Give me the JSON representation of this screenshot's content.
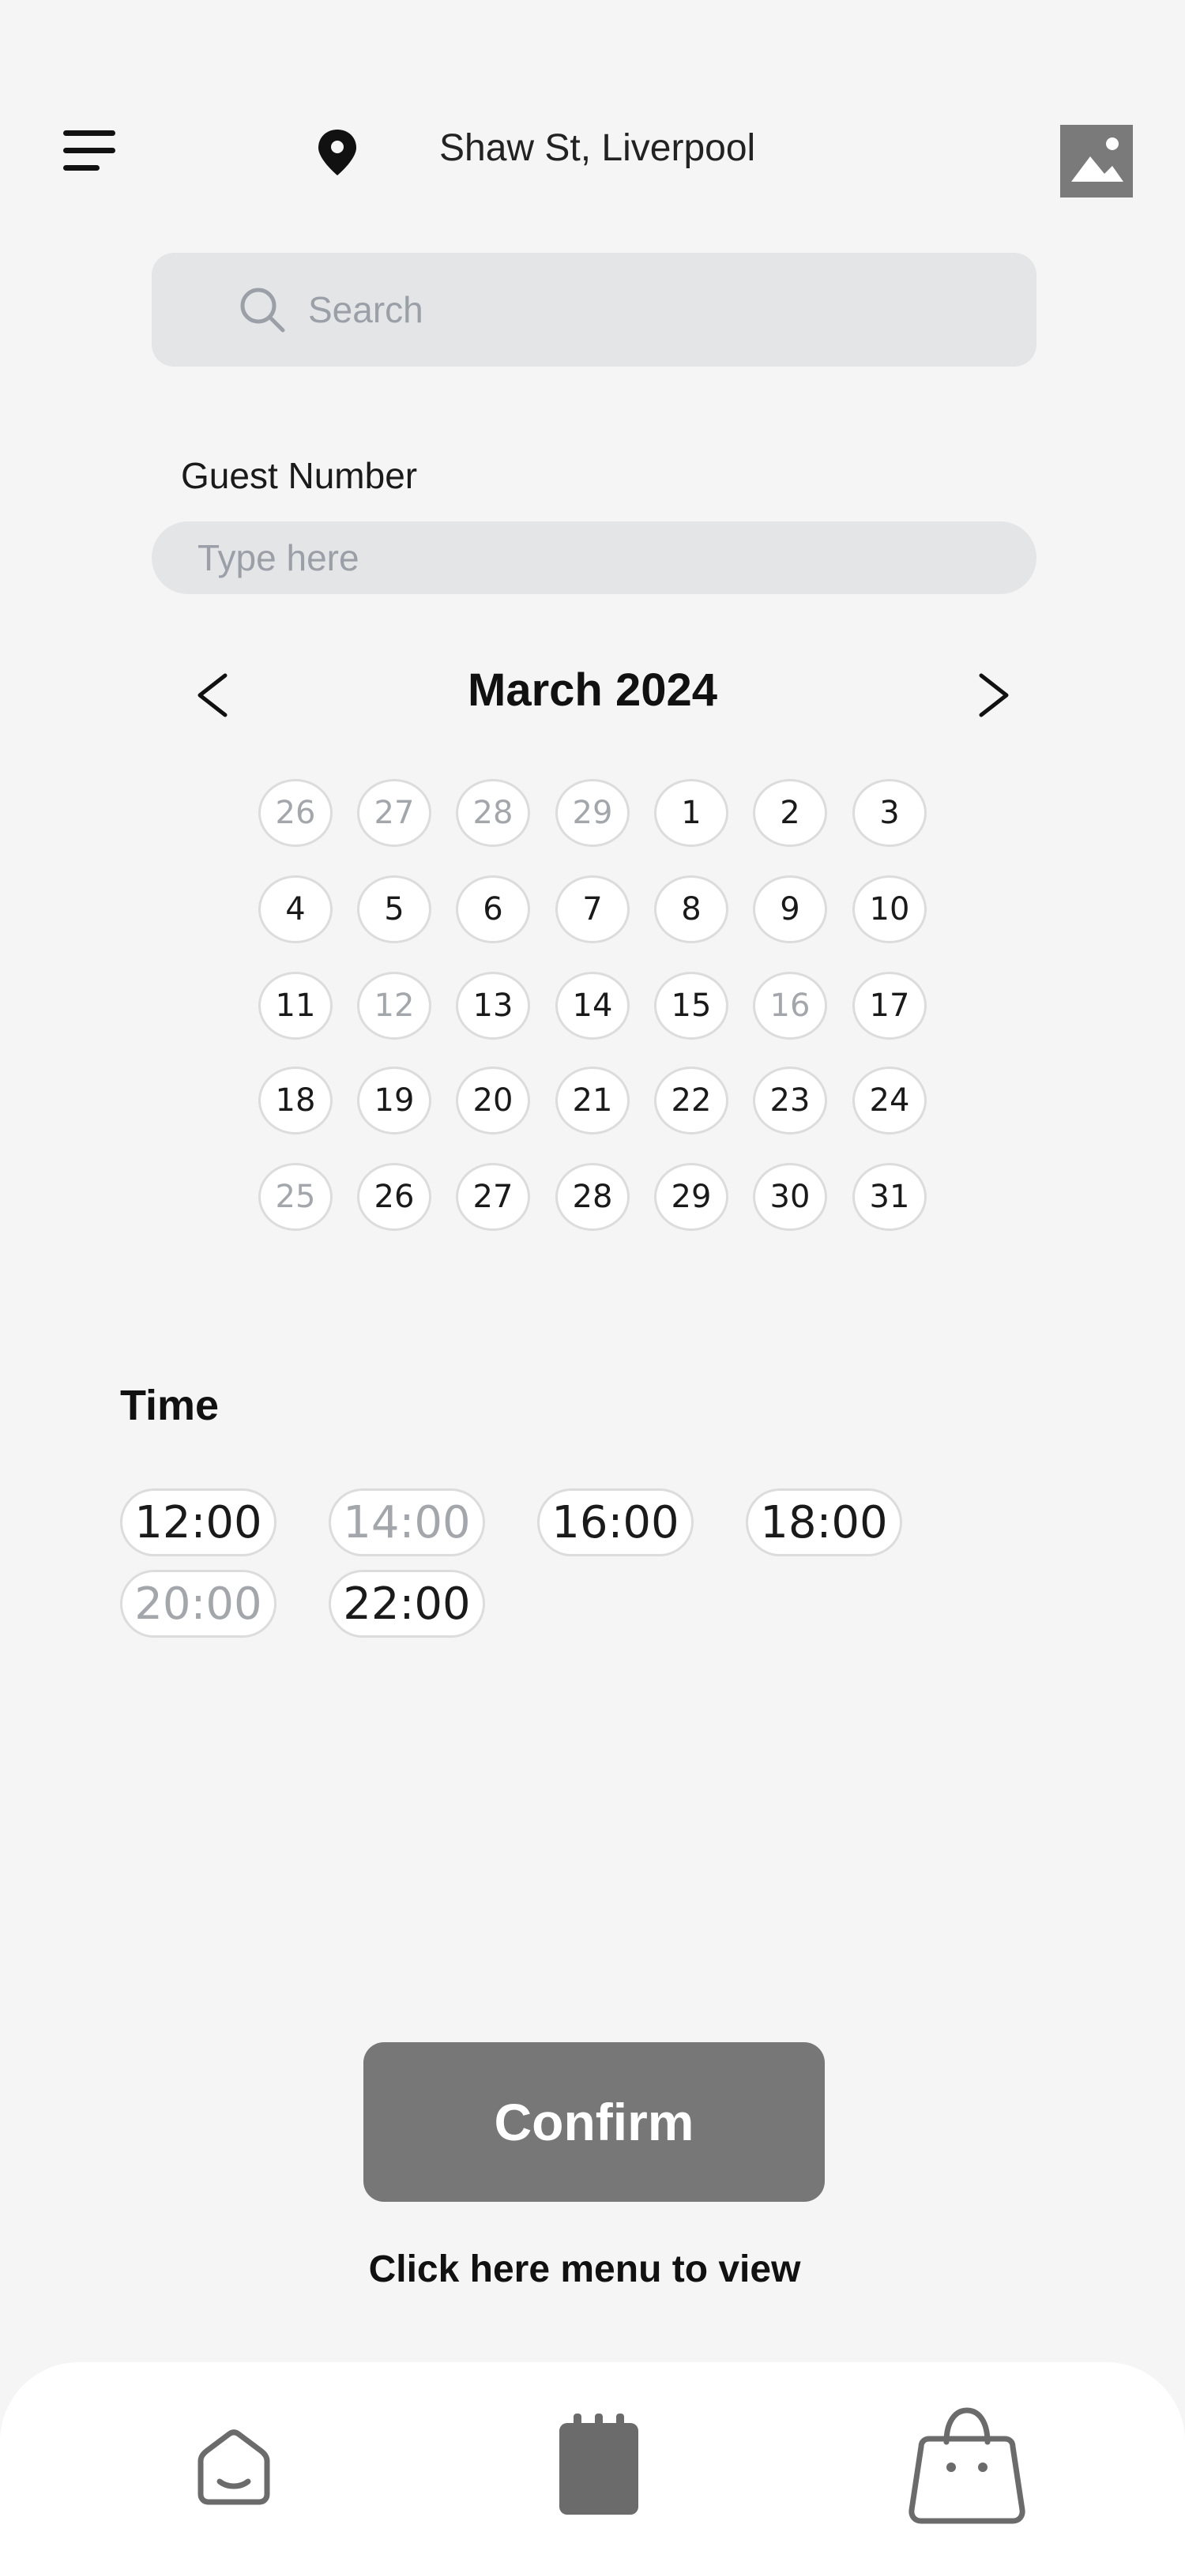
{
  "header": {
    "location": "Shaw St, Liverpool",
    "menu_icon": "hamburger-menu-icon",
    "pin_icon": "map-pin-icon",
    "avatar_icon": "image-placeholder-icon"
  },
  "search": {
    "placeholder": "Search",
    "icon": "search-icon"
  },
  "guest": {
    "label": "Guest Number",
    "placeholder": "Type here"
  },
  "calendar": {
    "month": "March 2024",
    "weeks": [
      [
        {
          "label": "26",
          "muted": true
        },
        {
          "label": "27",
          "muted": true
        },
        {
          "label": "28",
          "muted": true
        },
        {
          "label": "29",
          "muted": true
        },
        {
          "label": "1",
          "muted": false
        },
        {
          "label": "2",
          "muted": false
        },
        {
          "label": "3",
          "muted": false
        }
      ],
      [
        {
          "label": "4",
          "muted": false
        },
        {
          "label": "5",
          "muted": false
        },
        {
          "label": "6",
          "muted": false
        },
        {
          "label": "7",
          "muted": false
        },
        {
          "label": "8",
          "muted": false
        },
        {
          "label": "9",
          "muted": false
        },
        {
          "label": "10",
          "muted": false
        }
      ],
      [
        {
          "label": "11",
          "muted": false
        },
        {
          "label": "12",
          "muted": true
        },
        {
          "label": "13",
          "muted": false
        },
        {
          "label": "14",
          "muted": false
        },
        {
          "label": "15",
          "muted": false
        },
        {
          "label": "16",
          "muted": true
        },
        {
          "label": "17",
          "muted": false
        }
      ],
      [
        {
          "label": "18",
          "muted": false
        },
        {
          "label": "19",
          "muted": false
        },
        {
          "label": "20",
          "muted": false
        },
        {
          "label": "21",
          "muted": false
        },
        {
          "label": "22",
          "muted": false
        },
        {
          "label": "23",
          "muted": false
        },
        {
          "label": "24",
          "muted": false
        }
      ],
      [
        {
          "label": "25",
          "muted": true
        },
        {
          "label": "26",
          "muted": false
        },
        {
          "label": "27",
          "muted": false
        },
        {
          "label": "28",
          "muted": false
        },
        {
          "label": "29",
          "muted": false
        },
        {
          "label": "30",
          "muted": false
        },
        {
          "label": "31",
          "muted": false
        }
      ]
    ]
  },
  "time": {
    "title": "Time",
    "slots": [
      {
        "label": "12:00",
        "muted": false
      },
      {
        "label": "14:00",
        "muted": true
      },
      {
        "label": "16:00",
        "muted": false
      },
      {
        "label": "18:00",
        "muted": false
      },
      {
        "label": "20:00",
        "muted": true
      },
      {
        "label": "22:00",
        "muted": false
      }
    ]
  },
  "actions": {
    "confirm_label": "Confirm",
    "menu_link": "Click here menu to view"
  },
  "bottom_nav": [
    {
      "icon": "home-icon"
    },
    {
      "icon": "calendar-icon"
    },
    {
      "icon": "shopping-bag-icon"
    }
  ],
  "colors": {
    "background": "#f5f5f5",
    "field": "#e4e5e7",
    "button": "#777777",
    "muted_text": "#a3a6ab"
  }
}
